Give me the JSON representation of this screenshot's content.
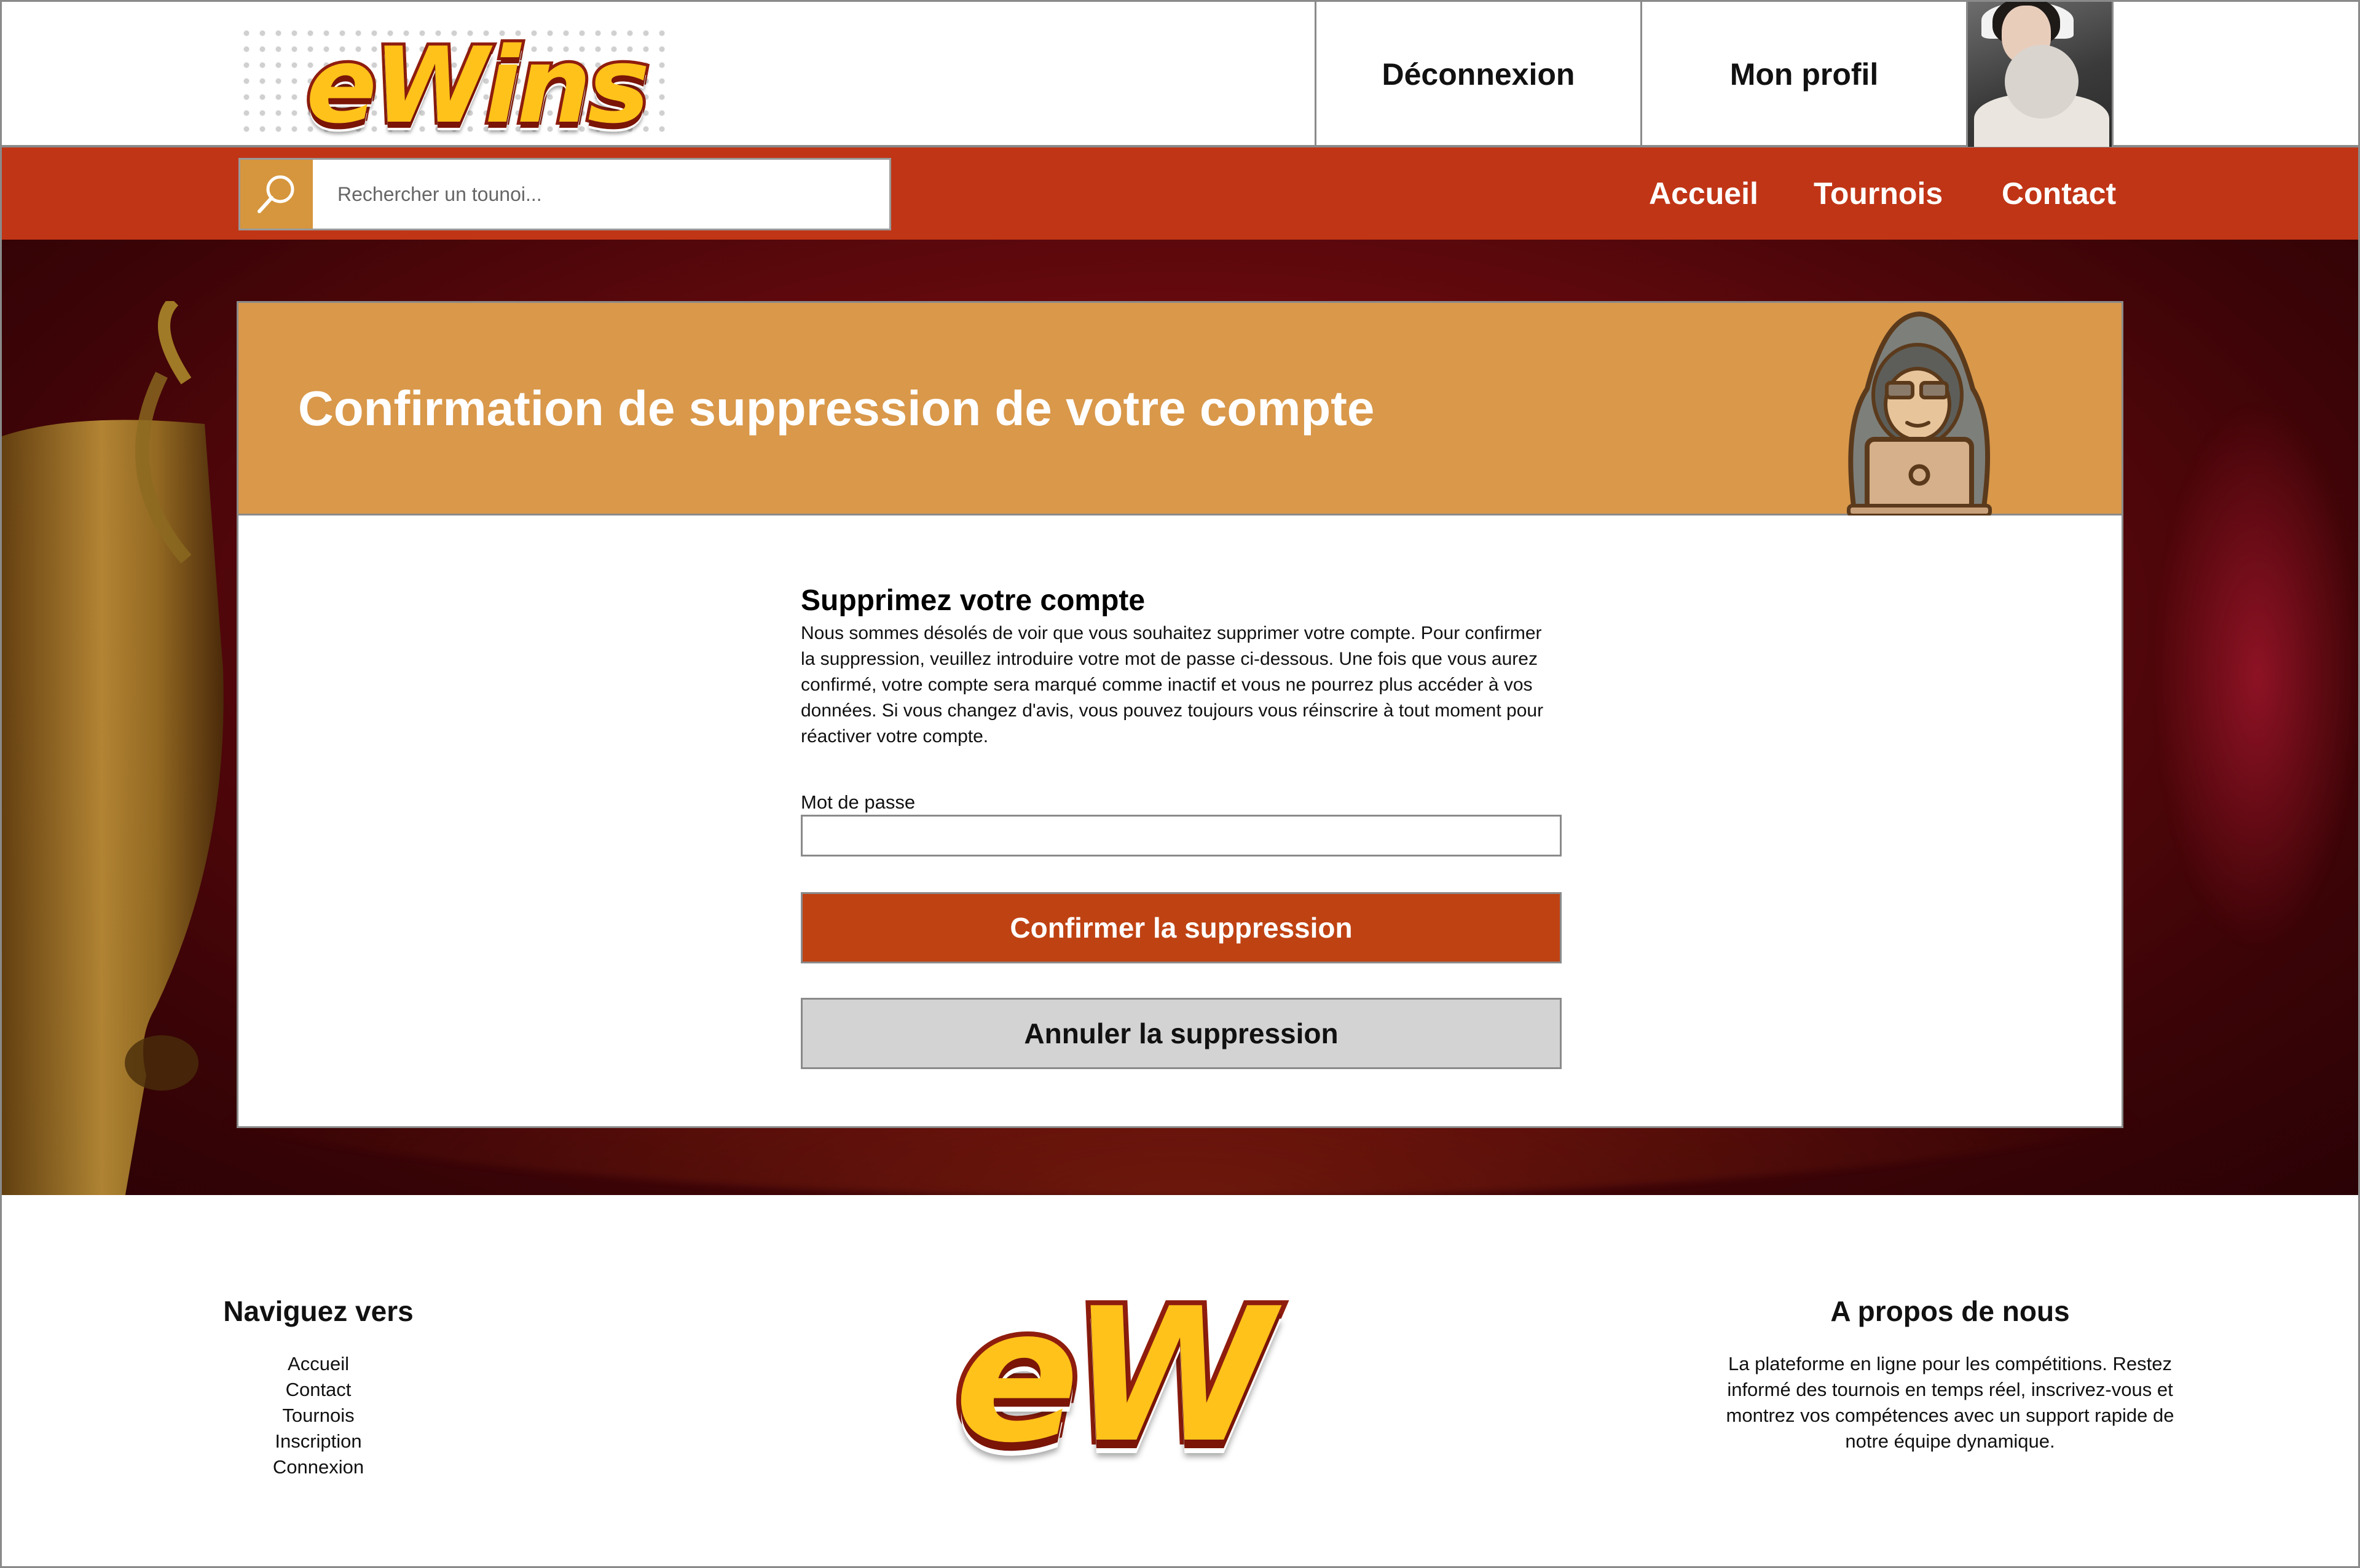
{
  "brand": {
    "logo_text": "eWins",
    "footer_logo_text": "eW"
  },
  "header": {
    "logout_label": "Déconnexion",
    "profile_label": "Mon profil"
  },
  "search": {
    "placeholder": "Rechercher un tounoi..."
  },
  "nav": {
    "items": [
      {
        "label": "Accueil"
      },
      {
        "label": "Tournois"
      },
      {
        "label": "Contact"
      }
    ]
  },
  "card": {
    "title": "Confirmation de suppression de votre compte",
    "heading": "Supprimez votre compte",
    "description": "Nous sommes désolés de voir que vous souhaitez supprimer votre compte. Pour confirmer la suppression, veuillez introduire votre mot de passe ci-dessous. Une fois que vous aurez confirmé, votre compte sera marqué comme inactif et vous ne pourrez plus accéder à vos données. Si vous changez d'avis, vous pouvez toujours vous réinscrire à tout moment pour réactiver votre compte.",
    "password_label": "Mot de passe",
    "password_value": "",
    "confirm_label": "Confirmer la suppression",
    "cancel_label": "Annuler la suppression"
  },
  "footer": {
    "nav_title": "Naviguez vers",
    "nav_links": [
      {
        "label": "Accueil"
      },
      {
        "label": "Contact"
      },
      {
        "label": "Tournois"
      },
      {
        "label": "Inscription"
      },
      {
        "label": "Connexion"
      }
    ],
    "about_title": "A propos de nous",
    "about_text": "La plateforme en ligne pour les compétitions. Restez informé des tournois en temps réel, inscrivez-vous et montrez vos compétences avec un support rapide de notre équipe dynamique."
  },
  "colors": {
    "primary": "#c03516",
    "accent": "#d9984a",
    "confirm": "#bf4213",
    "cancel": "#d3d3d3",
    "logo_yellow": "#ffc21a",
    "logo_outline": "#8f1d0e"
  },
  "icons": {
    "search": "search-icon",
    "avatar": "avatar",
    "hacker": "hacker-illustration",
    "trophy": "trophy-illustration"
  }
}
